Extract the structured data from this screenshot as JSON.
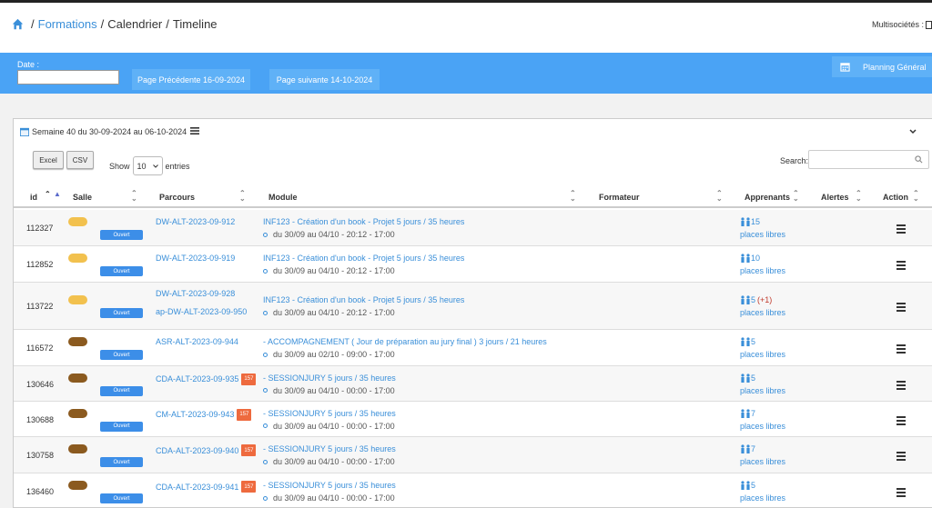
{
  "breadcrumb": {
    "formations": "Formations",
    "calendrier": "Calendrier",
    "timeline": "Timeline",
    "sep": "/"
  },
  "header": {
    "multisocietes": "Multisociétés :"
  },
  "toolbar": {
    "date_label": "Date :",
    "date_value": "",
    "prev_label": "Page Précédente 16-09-2024",
    "next_label": "Page suivante 14-10-2024",
    "planning_label": "Planning Général"
  },
  "panel": {
    "week_title": "Semaine 40 du 30-09-2024 au 06-10-2024",
    "excel": "Excel",
    "csv": "CSV",
    "show": "Show",
    "entries_value": "10",
    "entries": "entries",
    "search": "Search:"
  },
  "columns": {
    "id": "id",
    "salle": "Salle",
    "parcours": "Parcours",
    "module": "Module",
    "formateur": "Formateur",
    "apprenants": "Apprenants",
    "alertes": "Alertes",
    "action": "Action"
  },
  "colors": {
    "accent": "#4aa3f5",
    "link": "#3a8fd9",
    "ouvert": "#3c8ee8",
    "yellow": "#f2c14e",
    "brown": "#8b5a1f",
    "orange_badge": "#ee6a3e"
  },
  "rows": [
    {
      "id": "112327",
      "salle_color": "yellow",
      "status": "Ouvert",
      "parcours": [
        "DW-ALT-2023-09-912"
      ],
      "badge": "",
      "module": "INF123 - Création d'un book - Projet 5 jours / 35 heures",
      "dates": "du 30/09 au 04/10 - 20:12 - 17:00",
      "apprenants": "15",
      "plus": "",
      "places": "places libres"
    },
    {
      "id": "112852",
      "salle_color": "yellow",
      "status": "Ouvert",
      "parcours": [
        "DW-ALT-2023-09-919"
      ],
      "badge": "",
      "module": "INF123 - Création d'un book - Projet 5 jours / 35 heures",
      "dates": "du 30/09 au 04/10 - 20:12 - 17:00",
      "apprenants": "10",
      "plus": "",
      "places": "places libres"
    },
    {
      "id": "113722",
      "salle_color": "yellow",
      "status": "Ouvert",
      "parcours": [
        "DW-ALT-2023-09-928",
        "ap-DW-ALT-2023-09-950"
      ],
      "badge": "",
      "module": "INF123 - Création d'un book - Projet 5 jours / 35 heures",
      "dates": "du 30/09 au 04/10 - 20:12 - 17:00",
      "apprenants": "5",
      "plus": "(+1)",
      "places": "places libres"
    },
    {
      "id": "116572",
      "salle_color": "brown",
      "status": "Ouvert",
      "parcours": [
        "ASR-ALT-2023-09-944"
      ],
      "badge": "",
      "module": "- ACCOMPAGNEMENT ( Jour de préparation au jury final ) 3 jours / 21 heures",
      "dates": "du 30/09 au 02/10 - 09:00 - 17:00",
      "apprenants": "5",
      "plus": "",
      "places": "places libres"
    },
    {
      "id": "130646",
      "salle_color": "brown",
      "status": "Ouvert",
      "parcours": [
        "CDA-ALT-2023-09-935"
      ],
      "badge": "157",
      "module": "- SESSIONJURY 5 jours / 35 heures",
      "dates": "du 30/09 au 04/10 - 00:00 - 17:00",
      "apprenants": "5",
      "plus": "",
      "places": "places libres"
    },
    {
      "id": "130688",
      "salle_color": "brown",
      "status": "Ouvert",
      "parcours": [
        "CM-ALT-2023-09-943"
      ],
      "badge": "157",
      "module": "- SESSIONJURY 5 jours / 35 heures",
      "dates": "du 30/09 au 04/10 - 00:00 - 17:00",
      "apprenants": "7",
      "plus": "",
      "places": "places libres"
    },
    {
      "id": "130758",
      "salle_color": "brown",
      "status": "Ouvert",
      "parcours": [
        "CDA-ALT-2023-09-940"
      ],
      "badge": "157",
      "module": "- SESSIONJURY 5 jours / 35 heures",
      "dates": "du 30/09 au 04/10 - 00:00 - 17:00",
      "apprenants": "7",
      "plus": "",
      "places": "places libres"
    },
    {
      "id": "136460",
      "salle_color": "brown",
      "status": "Ouvert",
      "parcours": [
        "CDA-ALT-2023-09-941"
      ],
      "badge": "157",
      "module": "- SESSIONJURY 5 jours / 35 heures",
      "dates": "du 30/09 au 04/10 - 00:00 - 17:00",
      "apprenants": "5",
      "plus": "",
      "places": "places libres"
    }
  ]
}
